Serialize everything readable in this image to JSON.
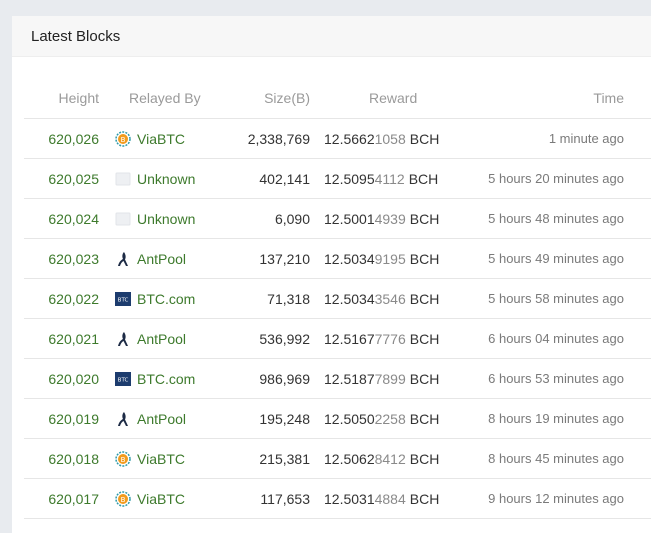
{
  "header": {
    "title": "Latest Blocks"
  },
  "columns": {
    "height": "Height",
    "relayed_by": "Relayed By",
    "size": "Size(B)",
    "reward": "Reward",
    "time": "Time"
  },
  "colors": {
    "link_green": "#3d7a2c",
    "viabtc_orange": "#f29b1d",
    "btccom_blue": "#1d3c6e",
    "antpool_navy": "#1d2b45"
  },
  "blocks": [
    {
      "height": "620,026",
      "pool": "ViaBTC",
      "icon": "viabtc-icon",
      "size": "2,338,769",
      "reward_main": "12.5662",
      "reward_tail": "1058",
      "unit": "BCH",
      "time": "1 minute ago"
    },
    {
      "height": "620,025",
      "pool": "Unknown",
      "icon": "unknown-icon",
      "size": "402,141",
      "reward_main": "12.5095",
      "reward_tail": "4112",
      "unit": "BCH",
      "time": "5 hours 20 minutes ago"
    },
    {
      "height": "620,024",
      "pool": "Unknown",
      "icon": "unknown-icon",
      "size": "6,090",
      "reward_main": "12.5001",
      "reward_tail": "4939",
      "unit": "BCH",
      "time": "5 hours 48 minutes ago"
    },
    {
      "height": "620,023",
      "pool": "AntPool",
      "icon": "antpool-icon",
      "size": "137,210",
      "reward_main": "12.5034",
      "reward_tail": "9195",
      "unit": "BCH",
      "time": "5 hours 49 minutes ago"
    },
    {
      "height": "620,022",
      "pool": "BTC.com",
      "icon": "btccom-icon",
      "size": "71,318",
      "reward_main": "12.5034",
      "reward_tail": "3546",
      "unit": "BCH",
      "time": "5 hours 58 minutes ago"
    },
    {
      "height": "620,021",
      "pool": "AntPool",
      "icon": "antpool-icon",
      "size": "536,992",
      "reward_main": "12.5167",
      "reward_tail": "7776",
      "unit": "BCH",
      "time": "6 hours 04 minutes ago"
    },
    {
      "height": "620,020",
      "pool": "BTC.com",
      "icon": "btccom-icon",
      "size": "986,969",
      "reward_main": "12.5187",
      "reward_tail": "7899",
      "unit": "BCH",
      "time": "6 hours 53 minutes ago"
    },
    {
      "height": "620,019",
      "pool": "AntPool",
      "icon": "antpool-icon",
      "size": "195,248",
      "reward_main": "12.5050",
      "reward_tail": "2258",
      "unit": "BCH",
      "time": "8 hours 19 minutes ago"
    },
    {
      "height": "620,018",
      "pool": "ViaBTC",
      "icon": "viabtc-icon",
      "size": "215,381",
      "reward_main": "12.5062",
      "reward_tail": "8412",
      "unit": "BCH",
      "time": "8 hours 45 minutes ago"
    },
    {
      "height": "620,017",
      "pool": "ViaBTC",
      "icon": "viabtc-icon",
      "size": "117,653",
      "reward_main": "12.5031",
      "reward_tail": "4884",
      "unit": "BCH",
      "time": "9 hours 12 minutes ago"
    }
  ]
}
